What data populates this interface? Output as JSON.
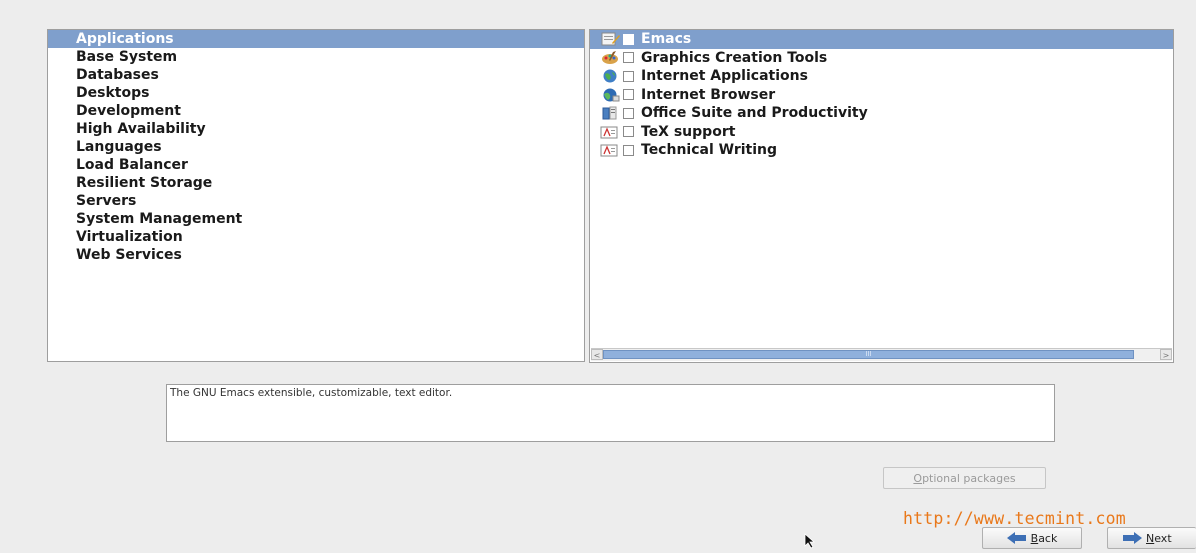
{
  "categories": {
    "items": [
      {
        "label": "Applications",
        "selected": true
      },
      {
        "label": "Base System",
        "selected": false
      },
      {
        "label": "Databases",
        "selected": false
      },
      {
        "label": "Desktops",
        "selected": false
      },
      {
        "label": "Development",
        "selected": false
      },
      {
        "label": "High Availability",
        "selected": false
      },
      {
        "label": "Languages",
        "selected": false
      },
      {
        "label": "Load Balancer",
        "selected": false
      },
      {
        "label": "Resilient Storage",
        "selected": false
      },
      {
        "label": "Servers",
        "selected": false
      },
      {
        "label": "System Management",
        "selected": false
      },
      {
        "label": "Virtualization",
        "selected": false
      },
      {
        "label": "Web Services",
        "selected": false
      }
    ]
  },
  "groups": {
    "items": [
      {
        "label": "Emacs",
        "icon": "text-editor-icon",
        "checked": false,
        "selected": true
      },
      {
        "label": "Graphics Creation Tools",
        "icon": "paint-palette-icon",
        "checked": false,
        "selected": false
      },
      {
        "label": "Internet Applications",
        "icon": "globe-icon",
        "checked": false,
        "selected": false
      },
      {
        "label": "Internet Browser",
        "icon": "browser-globe-icon",
        "checked": false,
        "selected": false
      },
      {
        "label": "Office Suite and Productivity",
        "icon": "office-documents-icon",
        "checked": false,
        "selected": false
      },
      {
        "label": "TeX support",
        "icon": "document-writer-icon",
        "checked": false,
        "selected": false
      },
      {
        "label": "Technical Writing",
        "icon": "document-writer-icon",
        "checked": false,
        "selected": false
      }
    ],
    "scrollbar_thumb_label": "III"
  },
  "description": {
    "text": "The GNU Emacs extensible, customizable, text editor."
  },
  "buttons": {
    "optional_packages_label": "Optional packages",
    "back_label": "Back",
    "next_label": "Next"
  },
  "watermark": {
    "text": "http://www.tecmint.com"
  },
  "colors": {
    "selection": "#7f9fcc",
    "background": "#ededed",
    "watermark": "#e9781a"
  }
}
